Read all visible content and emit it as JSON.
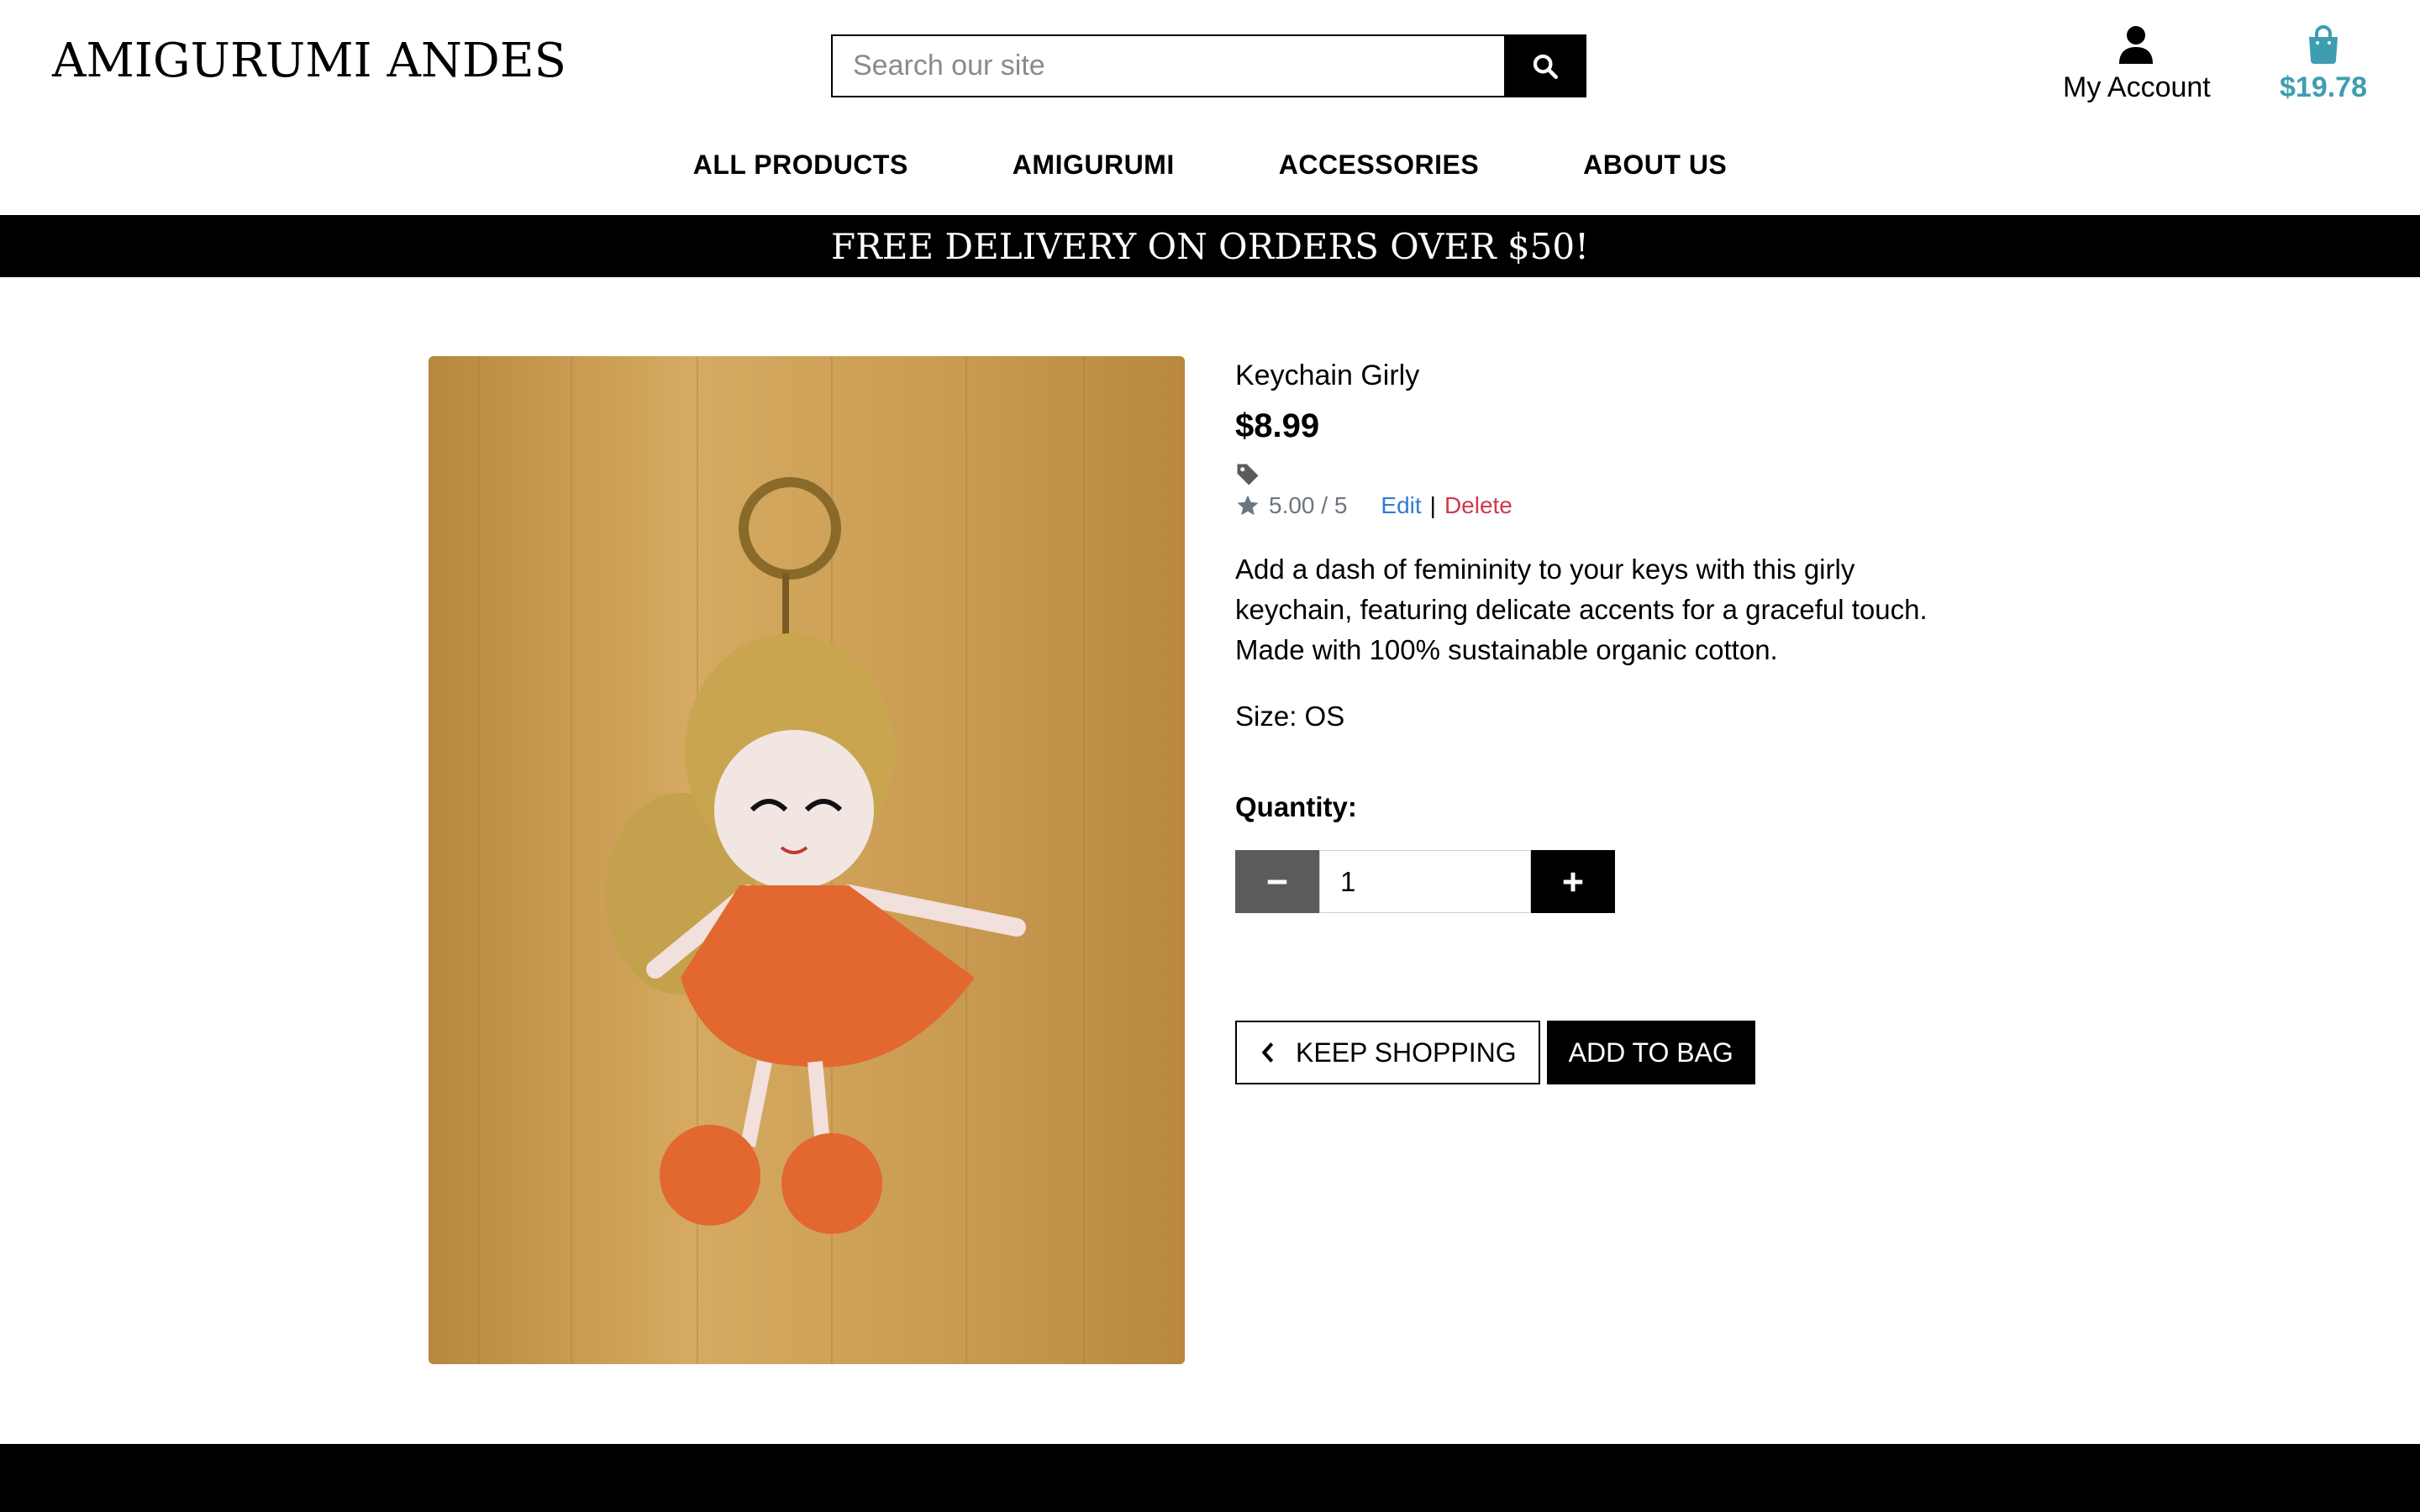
{
  "header": {
    "brand": "AMIGURUMI ANDES",
    "search_placeholder": "Search our site",
    "account_label": "My Account",
    "bag_total": "$19.78"
  },
  "nav": {
    "items": [
      "ALL PRODUCTS",
      "AMIGURUMI",
      "ACCESSORIES",
      "ABOUT US"
    ]
  },
  "banner": "FREE DELIVERY ON ORDERS OVER $50!",
  "product": {
    "name": "Keychain Girly",
    "price": "$8.99",
    "rating": "5.00 / 5",
    "edit_label": "Edit",
    "separator": "|",
    "delete_label": "Delete",
    "description": "Add a dash of femininity to your keys with this girly keychain, featuring delicate accents for a graceful touch. Made with 100% sustainable organic cotton.",
    "size": "Size: OS",
    "quantity_label": "Quantity:",
    "quantity_value": "1"
  },
  "actions": {
    "keep_shopping": "KEEP SHOPPING",
    "add_to_bag": "ADD TO BAG"
  },
  "colors": {
    "accent_bag": "#3f9db2",
    "edit_link": "#2f7cd6",
    "delete_link": "#d1394b",
    "banner_bg": "#000000"
  },
  "icons": {
    "search": "search-icon",
    "account": "user-icon",
    "bag": "shopping-bag-icon",
    "tag": "tag-icon",
    "star": "star-icon",
    "minus": "minus-icon",
    "plus": "plus-icon",
    "chevron": "chevron-left-icon"
  }
}
